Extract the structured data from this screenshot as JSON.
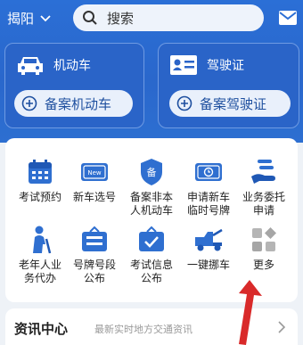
{
  "header": {
    "city": "揭阳",
    "search_placeholder": "搜索"
  },
  "cards": [
    {
      "title": "机动车",
      "button": "备案机动车",
      "icon": "car-icon"
    },
    {
      "title": "驾驶证",
      "button": "备案驾驶证",
      "icon": "id-card-icon"
    }
  ],
  "services": [
    {
      "label1": "考试预约",
      "label2": "",
      "icon": "calendar-icon"
    },
    {
      "label1": "新车选号",
      "label2": "",
      "icon": "new-plate-icon"
    },
    {
      "label1": "备案非本",
      "label2": "人机动车",
      "icon": "shield-icon"
    },
    {
      "label1": "申请新车",
      "label2": "临时号牌",
      "icon": "temp-plate-icon"
    },
    {
      "label1": "业务委托",
      "label2": "申请",
      "icon": "hand-document-icon"
    },
    {
      "label1": "老年人业",
      "label2": "务代办",
      "icon": "elderly-icon"
    },
    {
      "label1": "号牌号段",
      "label2": "公布",
      "icon": "plate-board-icon"
    },
    {
      "label1": "考试信息",
      "label2": "公布",
      "icon": "exam-info-icon"
    },
    {
      "label1": "一键挪车",
      "label2": "",
      "icon": "tow-truck-icon"
    },
    {
      "label1": "更多",
      "label2": "",
      "icon": "more-grid-icon"
    }
  ],
  "news": {
    "title": "资讯中心",
    "subtitle": "最新实时地方交通资讯"
  },
  "colors": {
    "brand_blue": "#2b6fd6",
    "accent_red": "#d92a2a"
  }
}
